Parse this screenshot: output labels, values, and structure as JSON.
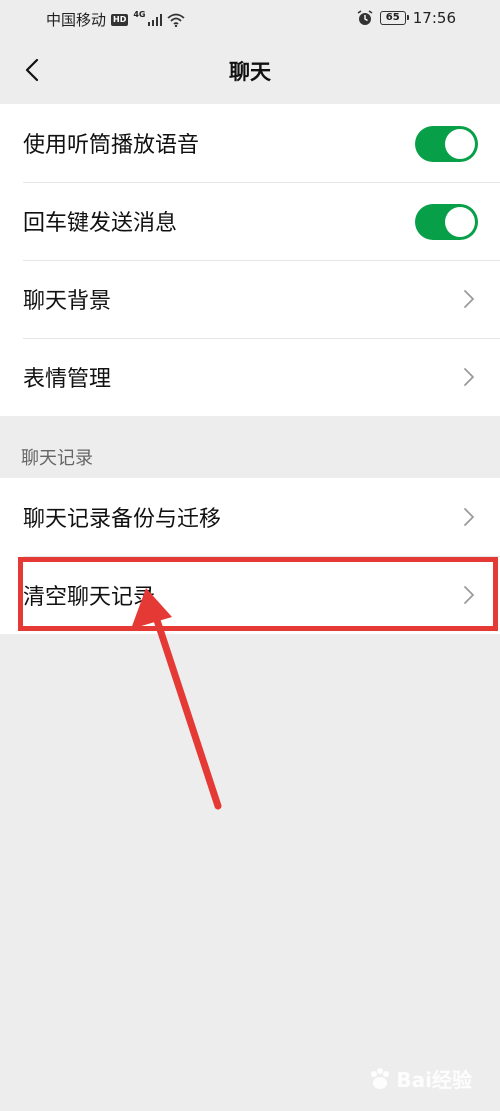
{
  "status_bar": {
    "carrier": "中国移动",
    "hd": "HD",
    "network": "4G",
    "battery": "65",
    "time": "17:56"
  },
  "nav": {
    "title": "聊天"
  },
  "settings_group": {
    "items": [
      {
        "label": "使用听筒播放语音",
        "control": "toggle",
        "on": true
      },
      {
        "label": "回车键发送消息",
        "control": "toggle",
        "on": true
      },
      {
        "label": "聊天背景",
        "control": "chevron"
      },
      {
        "label": "表情管理",
        "control": "chevron"
      }
    ]
  },
  "history_section": {
    "header": "聊天记录",
    "items": [
      {
        "label": "聊天记录备份与迁移",
        "control": "chevron"
      },
      {
        "label": "清空聊天记录",
        "control": "chevron"
      }
    ]
  },
  "colors": {
    "toggle_on": "#07a048",
    "annotation": "#e53935",
    "background": "#ededed"
  },
  "watermark": {
    "text": "Bai经验"
  }
}
